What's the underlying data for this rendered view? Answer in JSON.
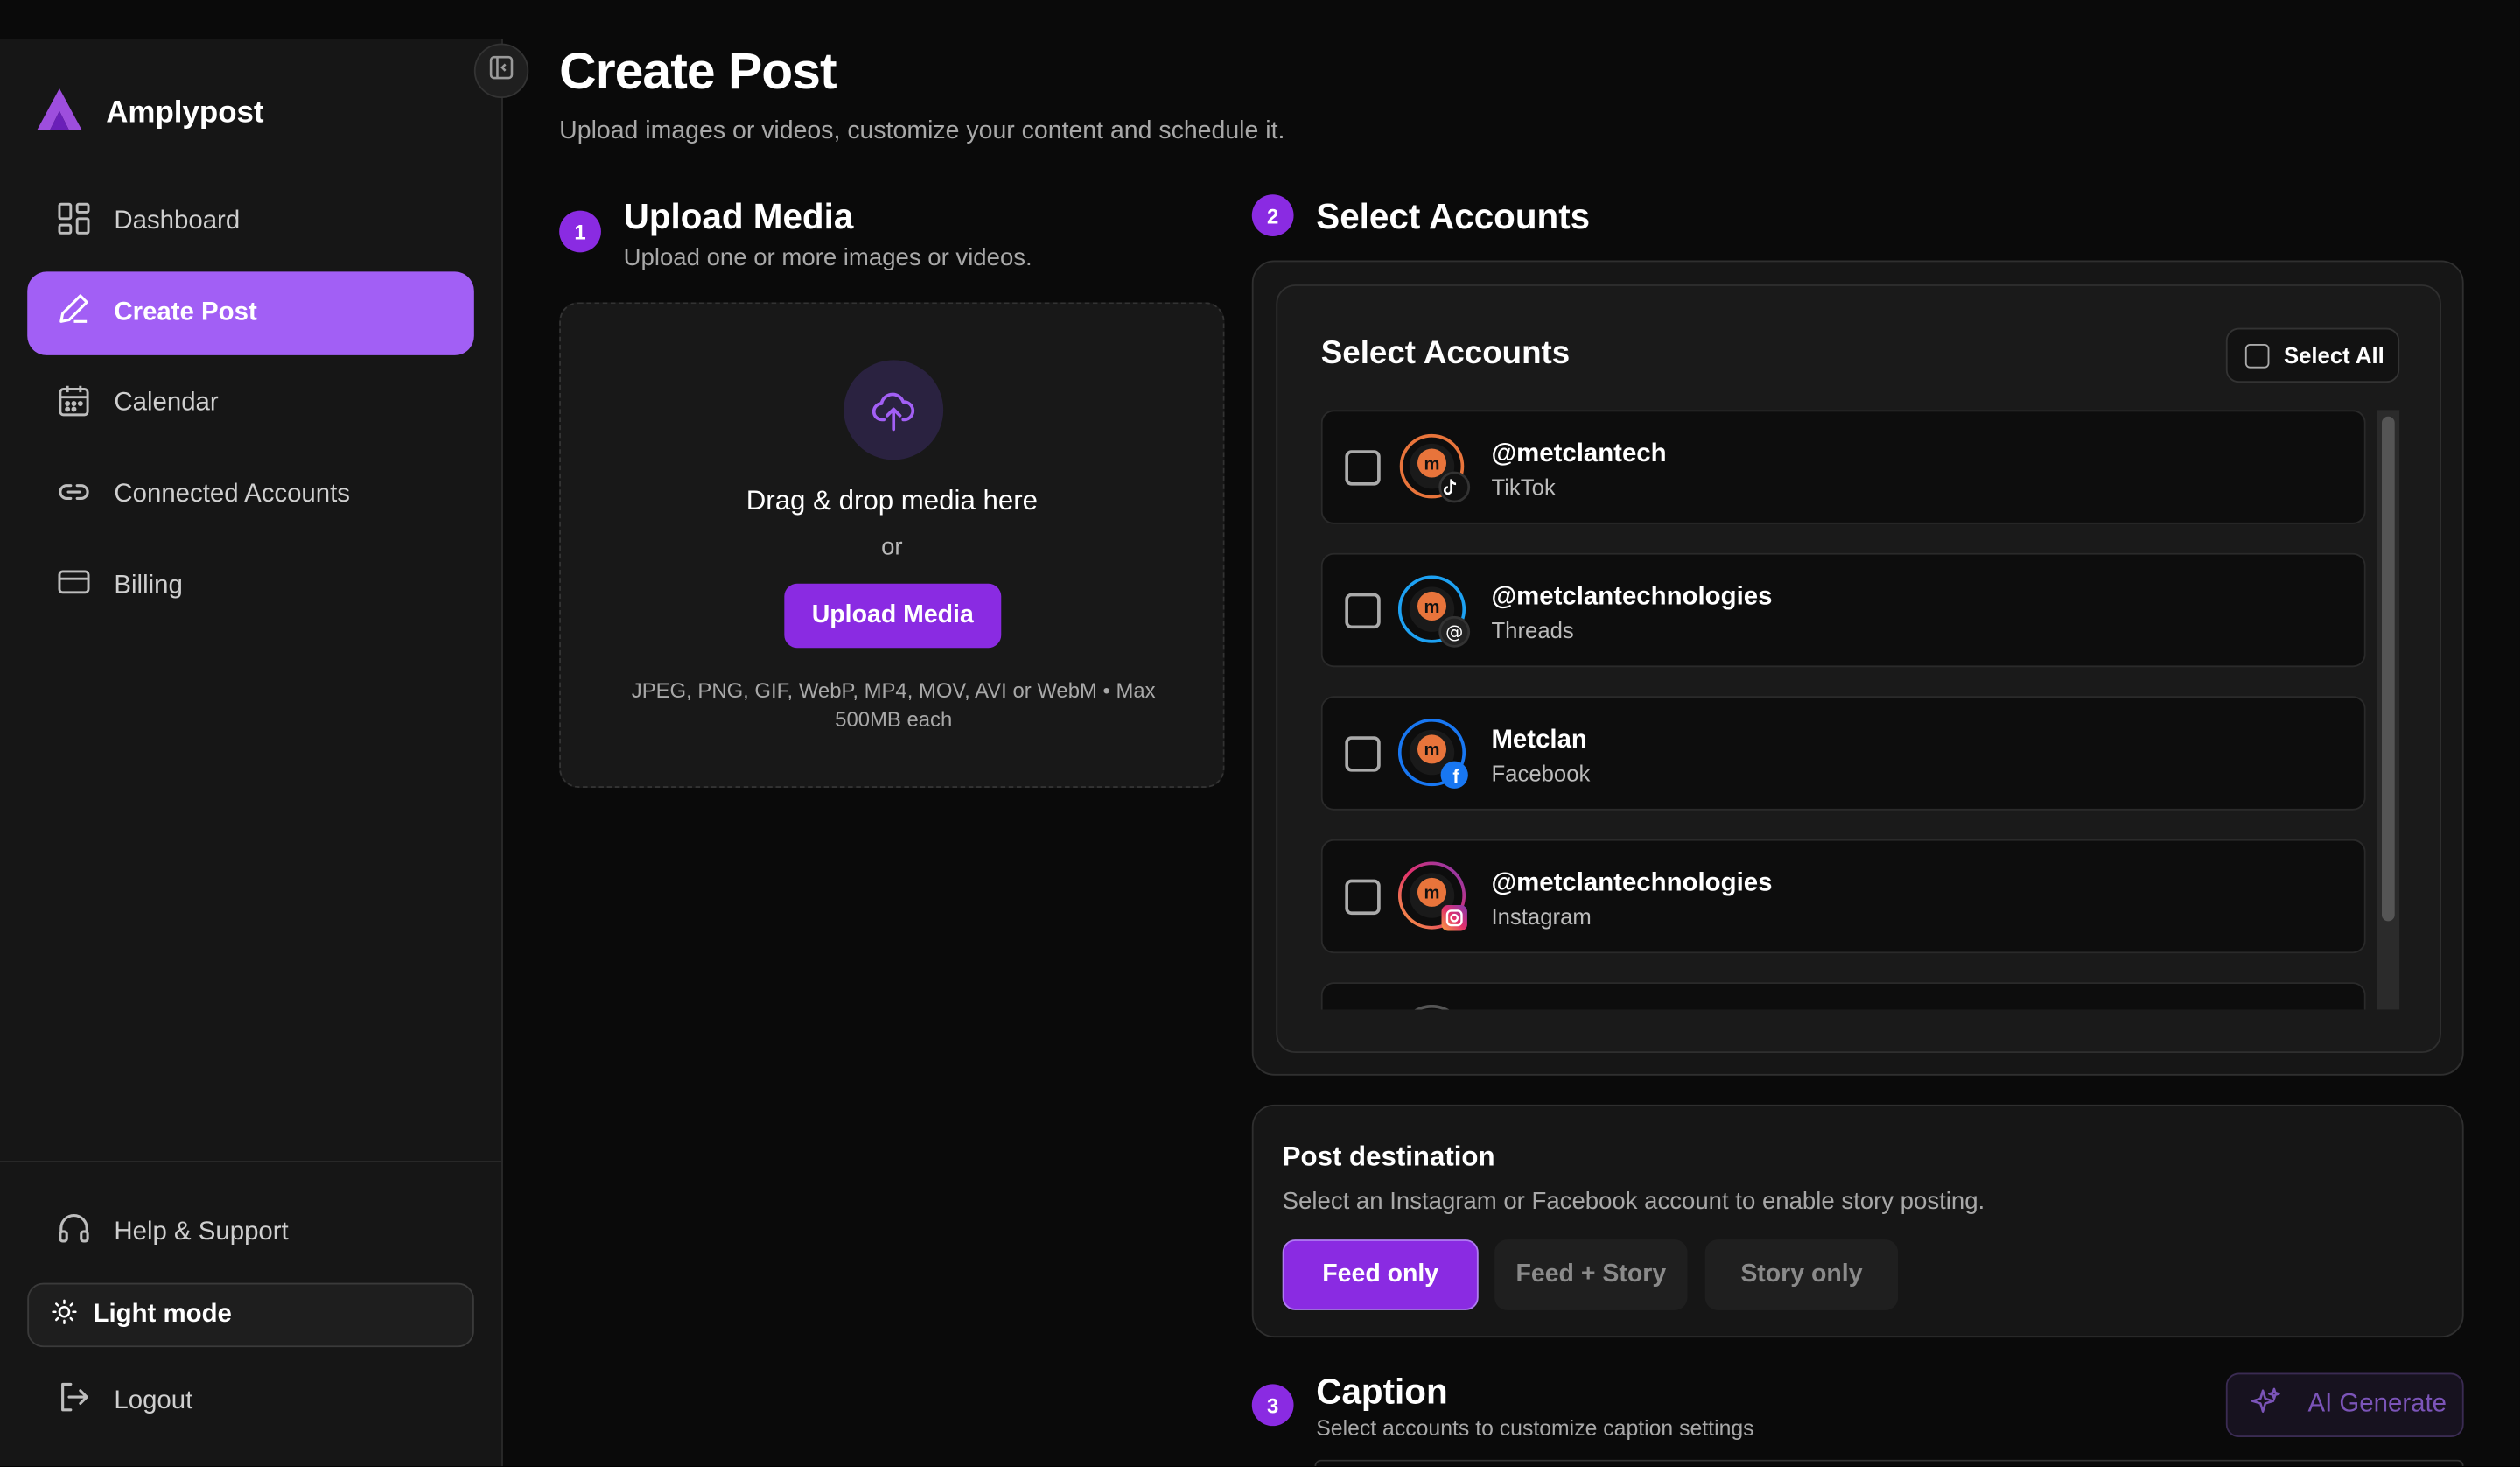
{
  "brand": {
    "name": "Amplypost",
    "accent": "#a25ff5",
    "primary": "#8a2be2"
  },
  "sidebar": {
    "items": [
      {
        "label": "Dashboard",
        "icon": "dashboard-grid-icon"
      },
      {
        "label": "Create Post",
        "icon": "pen-icon",
        "active": true
      },
      {
        "label": "Calendar",
        "icon": "calendar-icon"
      },
      {
        "label": "Connected Accounts",
        "icon": "link-icon"
      },
      {
        "label": "Billing",
        "icon": "credit-card-icon"
      }
    ],
    "help_label": "Help & Support",
    "light_mode_label": "Light mode",
    "logout_label": "Logout"
  },
  "page": {
    "title": "Create Post",
    "subtitle": "Upload images or videos, customize your content and schedule it."
  },
  "upload": {
    "step": "1",
    "title": "Upload Media",
    "subtitle": "Upload one or more images or videos.",
    "drop_text": "Drag & drop media here",
    "or_text": "or",
    "button_label": "Upload Media",
    "note": "JPEG, PNG, GIF, WebP, MP4, MOV, AVI or WebM • Max 500MB each"
  },
  "accounts": {
    "step": "2",
    "section_title": "Select Accounts",
    "panel_title": "Select Accounts",
    "select_all_label": "Select All",
    "list": [
      {
        "name": "@metclantech",
        "platform": "TikTok",
        "ring": "#e8743b",
        "badge_color": "#111111"
      },
      {
        "name": "@metclantechnologies",
        "platform": "Threads",
        "ring": "#1da1f2",
        "badge_color": "#222222"
      },
      {
        "name": "Metclan",
        "platform": "Facebook",
        "ring": "#1877f2",
        "badge_color": "#1877f2"
      },
      {
        "name": "@metclantechnologies",
        "platform": "Instagram",
        "ring": "#c13584",
        "badge_color": "#e1306c"
      }
    ]
  },
  "destination": {
    "title": "Post destination",
    "subtitle": "Select an Instagram or Facebook account to enable story posting.",
    "options": [
      "Feed only",
      "Feed + Story",
      "Story only"
    ],
    "selected": "Feed only"
  },
  "caption": {
    "step": "3",
    "title": "Caption",
    "subtitle": "Select accounts to customize caption settings",
    "ai_label": "AI Generate"
  }
}
